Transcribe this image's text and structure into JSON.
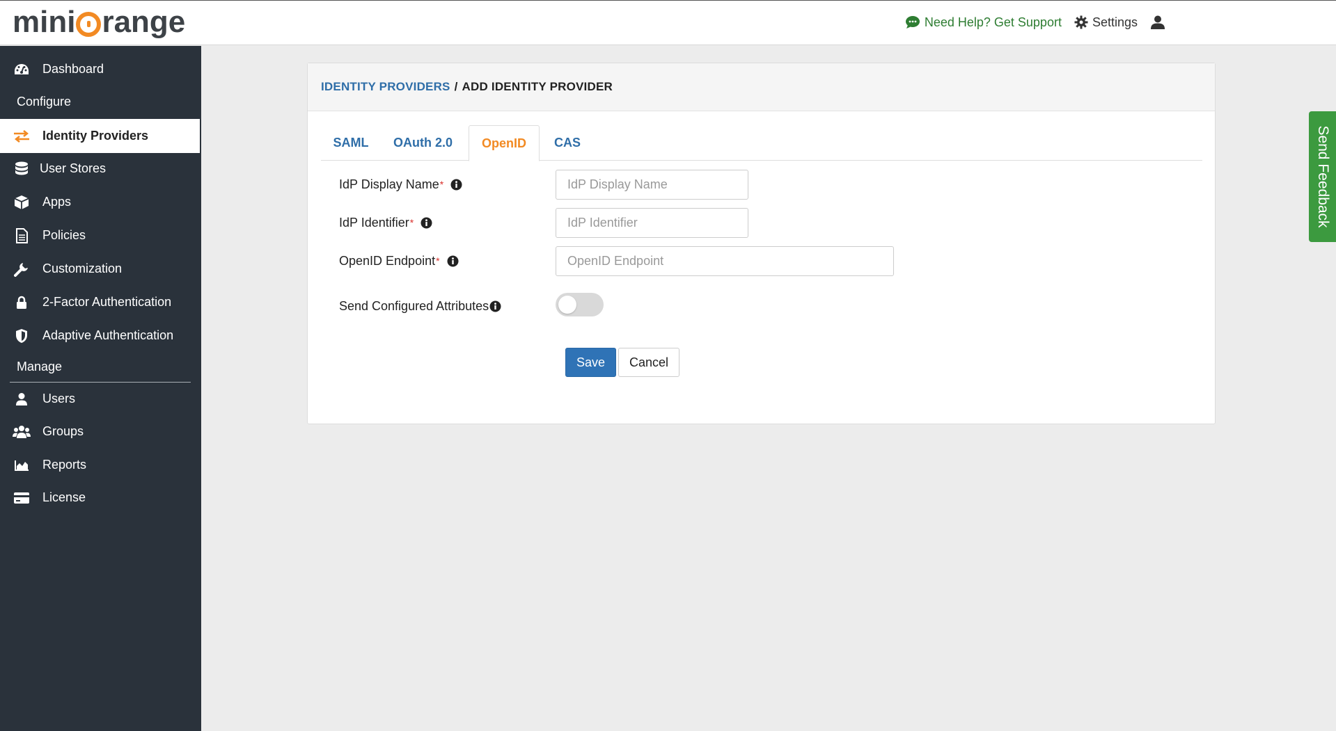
{
  "brand": {
    "logo_part1": "mini",
    "logo_part2": "range",
    "accent": "#f28a23"
  },
  "header": {
    "help_label": "Need Help? Get Support",
    "settings_label": "Settings"
  },
  "sidebar": {
    "items": [
      {
        "label": "Dashboard",
        "icon": "dashboard-icon"
      },
      {
        "label": "Identity Providers",
        "icon": "exchange-arrows-icon",
        "active": true
      },
      {
        "label": "User Stores",
        "icon": "database-icon"
      },
      {
        "label": "Apps",
        "icon": "cube-icon"
      },
      {
        "label": "Policies",
        "icon": "document-icon"
      },
      {
        "label": "Customization",
        "icon": "wrench-icon"
      },
      {
        "label": "2-Factor Authentication",
        "icon": "lock-icon"
      },
      {
        "label": "Adaptive Authentication",
        "icon": "shield-icon"
      },
      {
        "label": "Users",
        "icon": "user-icon"
      },
      {
        "label": "Groups",
        "icon": "group-icon"
      },
      {
        "label": "Reports",
        "icon": "area-chart-icon"
      },
      {
        "label": "License",
        "icon": "credit-card-icon"
      }
    ],
    "sections": {
      "configure": "Configure",
      "manage": "Manage"
    }
  },
  "main": {
    "breadcrumb": {
      "parent": "IDENTITY PROVIDERS",
      "separator": "/",
      "current": "ADD IDENTITY PROVIDER"
    },
    "tabs": [
      {
        "label": "SAML"
      },
      {
        "label": "OAuth 2.0"
      },
      {
        "label": "OpenID",
        "active": true
      },
      {
        "label": "CAS"
      }
    ],
    "form": {
      "display_name": {
        "label": "IdP Display Name",
        "required": "*",
        "placeholder": "IdP Display Name",
        "value": ""
      },
      "identifier": {
        "label": "IdP Identifier",
        "required": "*",
        "placeholder": "IdP Identifier",
        "value": ""
      },
      "endpoint": {
        "label": "OpenID Endpoint",
        "required": "*",
        "placeholder": "OpenID Endpoint",
        "value": ""
      },
      "send_attrs": {
        "label": "Send Configured Attributes",
        "enabled": false
      }
    },
    "buttons": {
      "save": "Save",
      "cancel": "Cancel"
    }
  },
  "feedback": {
    "label": "Send Feedback",
    "color": "#3c9a3f"
  }
}
